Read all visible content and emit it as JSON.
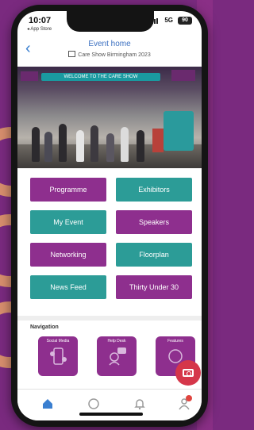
{
  "status_bar": {
    "time": "10:07",
    "back_app": "◂ App Store",
    "network": "5G",
    "battery": "90"
  },
  "header": {
    "title": "Event home",
    "subtitle": "Care Show Birmingham 2023"
  },
  "hero": {
    "banner_text": "WELCOME TO THE CARE SHOW"
  },
  "buttons": [
    {
      "label": "Programme",
      "color": "purple"
    },
    {
      "label": "Exhibitors",
      "color": "teal"
    },
    {
      "label": "My Event",
      "color": "teal"
    },
    {
      "label": "Speakers",
      "color": "purple"
    },
    {
      "label": "Networking",
      "color": "purple"
    },
    {
      "label": "Floorplan",
      "color": "teal"
    },
    {
      "label": "News Feed",
      "color": "teal"
    },
    {
      "label": "Thirty Under 30",
      "color": "purple"
    }
  ],
  "navigation": {
    "title": "Navigation",
    "tiles": [
      {
        "label": "Social Media",
        "icon": "phone-social-icon"
      },
      {
        "label": "Help Desk",
        "icon": "headset-chat-icon"
      },
      {
        "label": "Features",
        "icon": "features-icon"
      }
    ]
  },
  "fab": {
    "icon": "camera-icon"
  },
  "tabbar": {
    "items": [
      "home-icon",
      "chat-icon",
      "bell-icon",
      "profile-icon"
    ]
  },
  "colors": {
    "purple": "#8e2f8e",
    "teal": "#2c9c97",
    "accent_blue": "#3a7fd0",
    "fab_red": "#d5364a"
  }
}
